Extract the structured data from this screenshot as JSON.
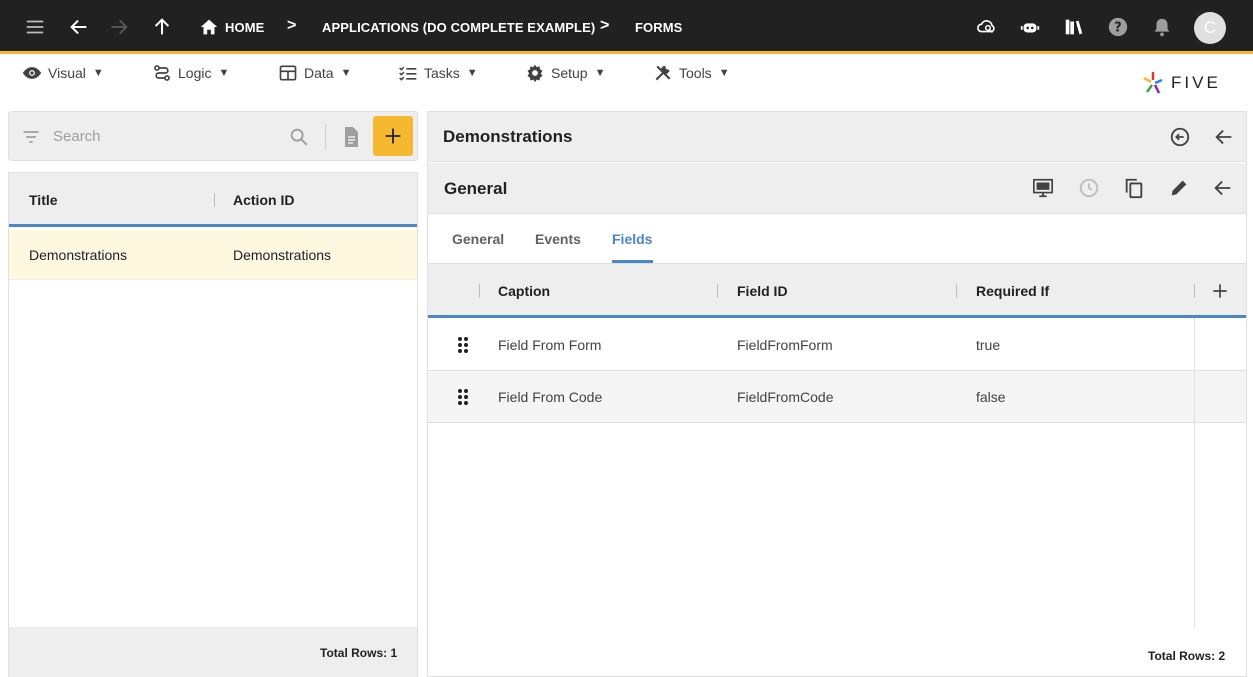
{
  "topbar": {
    "breadcrumbs": [
      "HOME",
      "APPLICATIONS (DO COMPLETE EXAMPLE)",
      "FORMS"
    ],
    "separator": ">",
    "avatar_initial": "C",
    "icons": [
      "menu-icon",
      "back-arrow-icon",
      "forward-arrow-icon",
      "up-arrow-icon",
      "home-icon",
      "cloud-search-icon",
      "chatbot-icon",
      "library-icon",
      "help-icon",
      "bell-icon"
    ],
    "accent_color": "#f5b82e"
  },
  "menubar": {
    "items": [
      {
        "label": "Visual",
        "icon": "eye-icon"
      },
      {
        "label": "Logic",
        "icon": "logic-icon"
      },
      {
        "label": "Data",
        "icon": "table-icon"
      },
      {
        "label": "Tasks",
        "icon": "checklist-icon"
      },
      {
        "label": "Setup",
        "icon": "gear-icon"
      },
      {
        "label": "Tools",
        "icon": "tools-icon"
      }
    ],
    "caret": "▼",
    "logo_text": "FIVE"
  },
  "left": {
    "search_placeholder": "Search",
    "columns": [
      "Title",
      "Action ID"
    ],
    "rows": [
      {
        "title": "Demonstrations",
        "action_id": "Demonstrations"
      }
    ],
    "footer": "Total Rows: 1"
  },
  "right": {
    "title": "Demonstrations",
    "section_title": "General",
    "tabs": [
      "General",
      "Events",
      "Fields"
    ],
    "active_tab": "Fields",
    "columns": [
      "Caption",
      "Field ID",
      "Required If"
    ],
    "rows": [
      {
        "caption": "Field From Form",
        "field_id": "FieldFromForm",
        "required_if": "true"
      },
      {
        "caption": "Field From Code",
        "field_id": "FieldFromCode",
        "required_if": "false"
      }
    ],
    "footer": "Total Rows: 2"
  },
  "colors": {
    "accent": "#f5b82e",
    "active_blue": "#4a86c8",
    "selected_row": "#fff8e1",
    "topbar": "#212121"
  }
}
